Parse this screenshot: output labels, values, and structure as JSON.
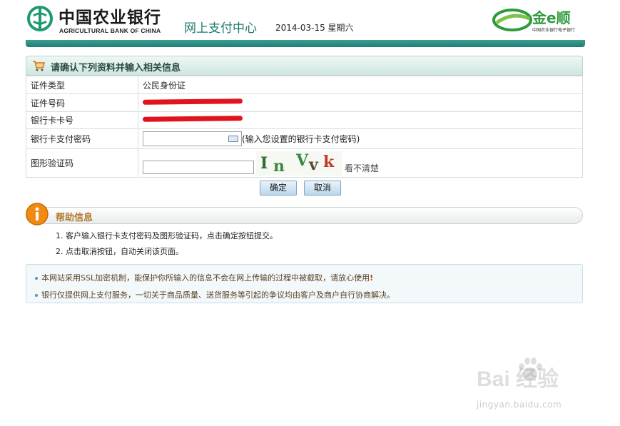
{
  "header": {
    "bank_name_cn": "中国农业银行",
    "bank_name_en": "AGRICULTURAL BANK OF CHINA",
    "center_title": "网上支付中心",
    "date": "2014-03-15 星期六",
    "jin_logo": "金e顺",
    "jin_sub": "中国农业银行电子银行"
  },
  "form": {
    "title": "请确认下列资料并输入相关信息",
    "rows": [
      {
        "label": "证件类型",
        "value": "公民身份证"
      },
      {
        "label": "证件号码",
        "value": "3**************************"
      },
      {
        "label": "银行卡卡号",
        "value": "62*************************"
      },
      {
        "label": "银行卡支付密码",
        "hint": "(输入您设置的银行卡支付密码)"
      },
      {
        "label": "图形验证码",
        "refresh": "看不清楚"
      }
    ],
    "captcha_chars": [
      "I",
      "n",
      "V",
      "v",
      "k"
    ],
    "ok": "确定",
    "cancel": "取消"
  },
  "help": {
    "title": "帮助信息",
    "items": [
      "1. 客户输入银行卡支付密码及图形验证码，点击确定按钮提交。",
      "2. 点击取消按钮，自动关闭该页面。"
    ]
  },
  "info": {
    "line1": "本网站采用SSL加密机制，能保护你所输入的信息不会在网上传输的过程中被截取，请放心使用",
    "line1_mark": "!",
    "line2": "银行仅提供网上支付服务，一切关于商品质量、送货服务等引起的争议均由客户及商户自行协商解决。"
  },
  "watermark": {
    "text": "Bai  经验",
    "url": "jingyan.baidu.com"
  },
  "colors": {
    "brand_teal": "#1f7d72",
    "mask_red": "#e0141e",
    "help_orange": "#f08a10"
  }
}
